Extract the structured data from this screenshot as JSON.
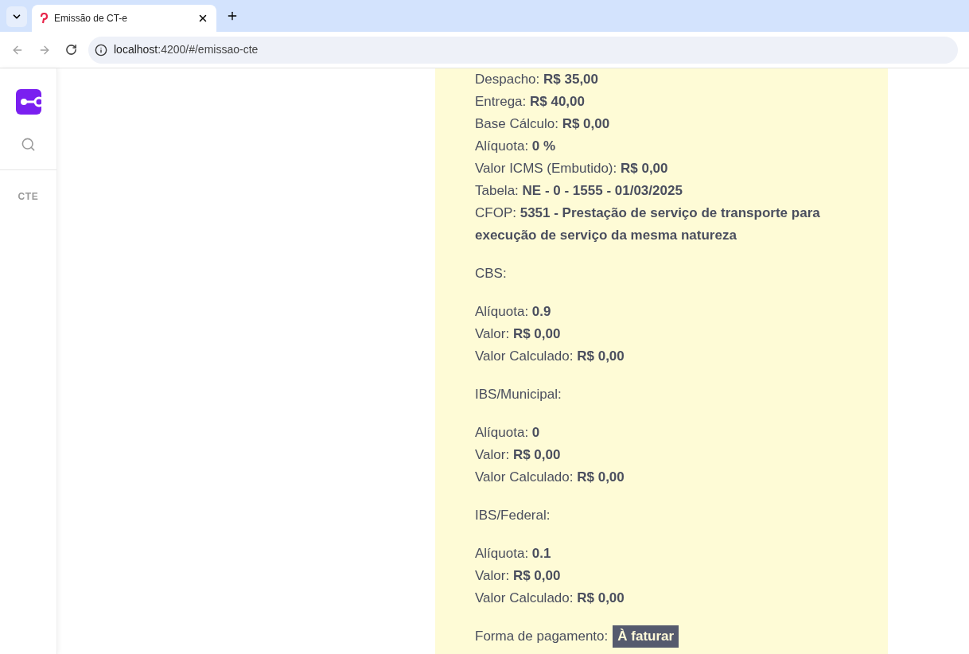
{
  "browser": {
    "tab_title": "Emissão de CT-e",
    "url_host": "localhost",
    "url_path": ":4200/#/emissao-cte"
  },
  "sidebar": {
    "items": [
      {
        "label": "CTE"
      }
    ]
  },
  "details": [
    {
      "kind": "field",
      "label": "Despacho:",
      "value": "R$ 35,00"
    },
    {
      "kind": "field",
      "label": "Entrega:",
      "value": "R$ 40,00"
    },
    {
      "kind": "field",
      "label": "Base Cálculo:",
      "value": "R$ 0,00"
    },
    {
      "kind": "field",
      "label": "Alíquota:",
      "value": "0 %"
    },
    {
      "kind": "field",
      "label": "Valor ICMS (Embutido):",
      "value": "R$ 0,00"
    },
    {
      "kind": "field",
      "label": "Tabela:",
      "value": "NE - 0 - 1555 - 01/03/2025"
    },
    {
      "kind": "field",
      "label": "CFOP:",
      "value": "5351 - Prestação de serviço de transporte para execução de serviço da mesma natureza"
    },
    {
      "kind": "heading",
      "label": "CBS:"
    },
    {
      "kind": "field",
      "label": "Alíquota:",
      "value": "0.9"
    },
    {
      "kind": "field",
      "label": "Valor:",
      "value": "R$ 0,00"
    },
    {
      "kind": "field",
      "label": "Valor Calculado:",
      "value": "R$ 0,00"
    },
    {
      "kind": "heading",
      "label": "IBS/Municipal:"
    },
    {
      "kind": "field",
      "label": "Alíquota:",
      "value": "0"
    },
    {
      "kind": "field",
      "label": "Valor:",
      "value": "R$ 0,00"
    },
    {
      "kind": "field",
      "label": "Valor Calculado:",
      "value": "R$ 0,00"
    },
    {
      "kind": "heading",
      "label": "IBS/Federal:"
    },
    {
      "kind": "field",
      "label": "Alíquota:",
      "value": "0.1"
    },
    {
      "kind": "field",
      "label": "Valor:",
      "value": "R$ 0,00"
    },
    {
      "kind": "field",
      "label": "Valor Calculado:",
      "value": "R$ 0,00"
    },
    {
      "kind": "badge",
      "label": "Forma de pagamento:",
      "value": "À faturar"
    }
  ]
}
